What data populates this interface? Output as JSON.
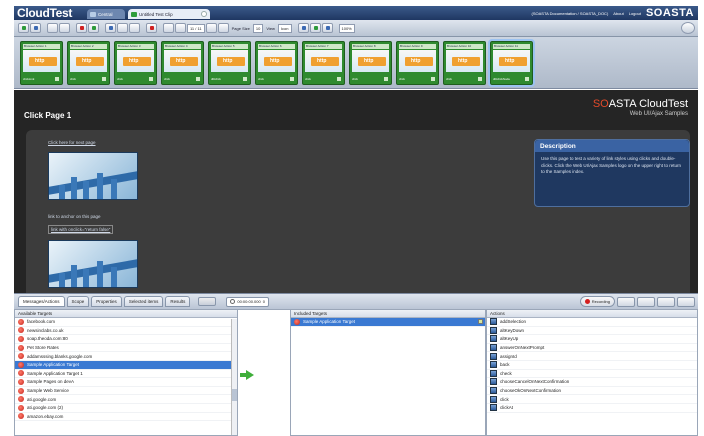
{
  "app": {
    "brand": "CloudTest",
    "tabs": [
      {
        "label": "Central"
      },
      {
        "label": "Untitled Test Clip"
      }
    ],
    "toplinks": [
      "(SOASTA Documentation / SOASTA_DOC)",
      "About",
      "Logout"
    ],
    "logo": "SOASTA"
  },
  "toolbar": {
    "step_display": "11 / 11",
    "page_size_label": "Page Size",
    "page_size_value": "10",
    "view_label": "View",
    "view_value": "Icon",
    "zoom_value": "100%"
  },
  "filmstrip": {
    "frames": [
      {
        "label": "Browser Action 1",
        "caption": "clickLink",
        "selected": false
      },
      {
        "label": "Browser Action 2",
        "caption": "click",
        "selected": false
      },
      {
        "label": "Browser Action 3",
        "caption": "click",
        "selected": false
      },
      {
        "label": "Browser Action 4",
        "caption": "click",
        "selected": false
      },
      {
        "label": "Browser Action 5",
        "caption": "dblclick",
        "selected": false
      },
      {
        "label": "Browser Action 6",
        "caption": "click",
        "selected": false
      },
      {
        "label": "Browser Action 7",
        "caption": "click",
        "selected": false
      },
      {
        "label": "Browser Action 8",
        "caption": "click",
        "selected": false
      },
      {
        "label": "Browser Action 9",
        "caption": "click",
        "selected": false
      },
      {
        "label": "Browser Action 10",
        "caption": "click",
        "selected": false
      },
      {
        "label": "Browser Action 11",
        "caption": "dblclickNode",
        "selected": true
      }
    ]
  },
  "webpage": {
    "brand_highlight": "SO",
    "brand_rest": "ASTA CloudTest",
    "brand_sub": "Web UI/Ajax Samples",
    "title": "Click Page 1",
    "link_next": "Click here for next page",
    "link_anchor": "link to anchor on this page",
    "link_onclick": "link with onclick=\"return false\"",
    "description_title": "Description",
    "description_text": "Use this page to test a variety of link styles using clicks and double-clicks. Click the Web UI/Ajax Samples logo on the upper right to return to the Samples index."
  },
  "bottom": {
    "tabs": [
      "Messages/Actions",
      "Scope",
      "Properties",
      "Selected items",
      "Results"
    ],
    "timer": "00:00:00.000",
    "timer_count": "0",
    "recording_label": "Recording",
    "available_header": "Available Targets",
    "available_targets": [
      "facebook.com",
      "newsinclabs.co.uk",
      "soap.theoda.com:80",
      "Pet Store Rates",
      "addamsssing.blanks.google.com",
      "Sample Application Target",
      "Sample Application Target 1",
      "Sample Pages on devA",
      "Sample Web Service",
      "ati.google.com",
      "ati.google.com (2)",
      "amazon.ebay.com"
    ],
    "selected_available_index": 5,
    "included_header": "Included Targets",
    "included_targets": [
      "Sample Application Target"
    ],
    "actions_header": "Actions",
    "actions": [
      "addSelection",
      "altKeyDown",
      "altKeyUp",
      "answerOnNextPrompt",
      "assignId",
      "back",
      "check",
      "chooseCancelOnNextConfirmation",
      "chooseOkOnNextConfirmation",
      "click",
      "clickAt"
    ]
  }
}
